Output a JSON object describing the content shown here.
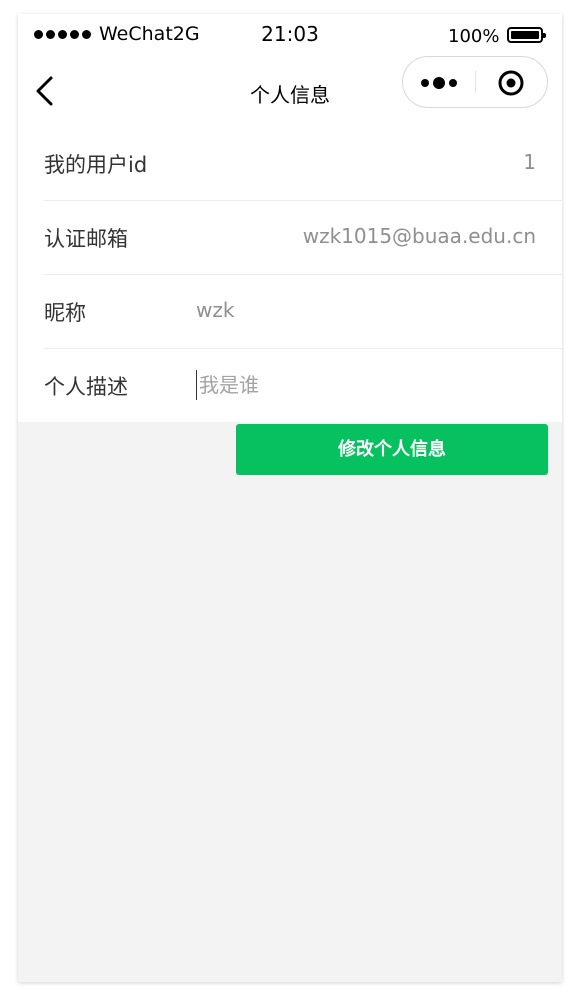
{
  "status_bar": {
    "carrier": "WeChat2G",
    "time": "21:03",
    "battery": "100%"
  },
  "nav": {
    "title": "个人信息",
    "back_icon": "chevron-left-icon",
    "menu_icon": "more-dots-icon",
    "close_icon": "target-circle-icon"
  },
  "form": {
    "user_id": {
      "label": "我的用户id",
      "value": "1"
    },
    "email": {
      "label": "认证邮箱",
      "value": "wzk1015@buaa.edu.cn"
    },
    "nickname": {
      "label": "昵称",
      "value": "wzk"
    },
    "description": {
      "label": "个人描述",
      "placeholder": "我是谁",
      "value": ""
    }
  },
  "submit_label": "修改个人信息",
  "colors": {
    "accent": "#07c160",
    "page_bg": "#f3f3f3",
    "muted_text": "#8f8f8f"
  }
}
